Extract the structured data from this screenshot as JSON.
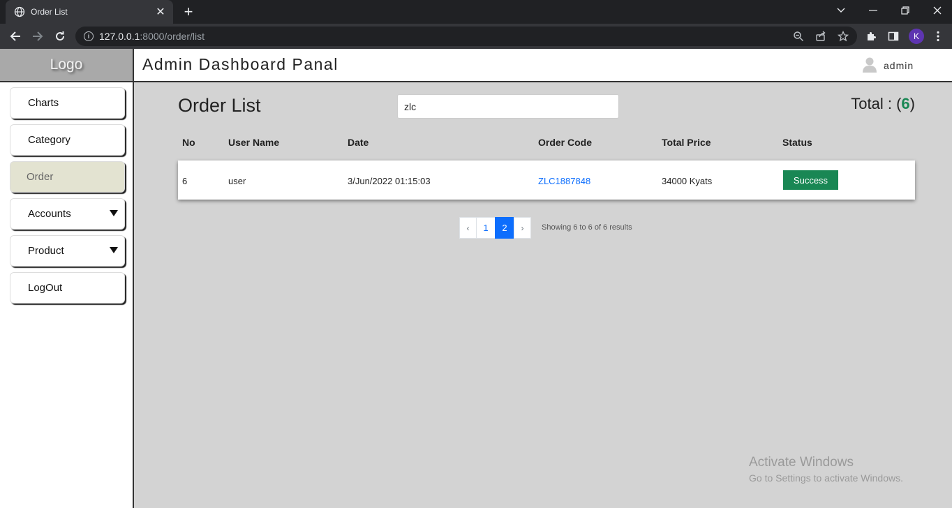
{
  "browser": {
    "tab_title": "Order List",
    "url_host": "127.0.0.1",
    "url_path": ":8000/order/list",
    "profile_initial": "K"
  },
  "sidebar": {
    "logo": "Logo",
    "items": [
      {
        "label": "Charts"
      },
      {
        "label": "Category"
      },
      {
        "label": "Order"
      },
      {
        "label": "Accounts"
      },
      {
        "label": "Product"
      },
      {
        "label": "LogOut"
      }
    ]
  },
  "header": {
    "title": "Admin Dashboard Panal",
    "user": "admin"
  },
  "main": {
    "title": "Order List",
    "search_value": "zlc",
    "total_label": "Total : (",
    "total_count": "6",
    "total_close": ")",
    "columns": [
      "No",
      "User Name",
      "Date",
      "Order Code",
      "Total Price",
      "Status"
    ],
    "rows": [
      {
        "no": "6",
        "user": "user",
        "date": "3/Jun/2022 01:15:03",
        "code": "ZLC1887848",
        "price": "34000 Kyats",
        "status": "Success"
      }
    ],
    "pagination": {
      "prev": "‹",
      "pages": [
        "1",
        "2"
      ],
      "current": "2",
      "next": "›",
      "summary": "Showing 6 to 6 of 6 results"
    }
  },
  "watermark": {
    "line1": "Activate Windows",
    "line2": "Go to Settings to activate Windows."
  },
  "colors": {
    "accent": "#0d6efd",
    "success": "#198754",
    "sidebar_active": "#e3e3d1"
  }
}
